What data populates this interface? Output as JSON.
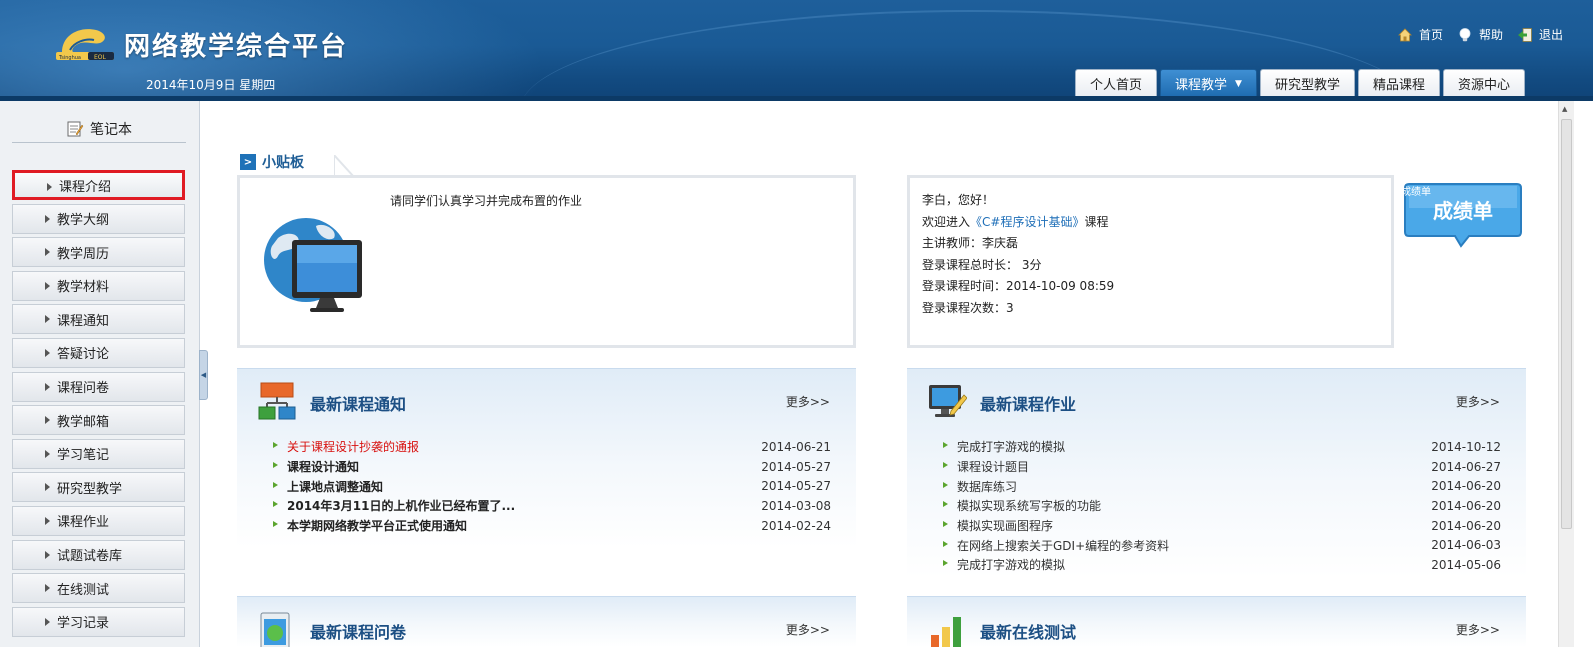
{
  "header": {
    "title": "网络教学综合平台",
    "logo_tag": "Tsinghua EOL",
    "date": "2014年10月9日 星期四",
    "links": [
      {
        "label": "首页",
        "icon": "home-icon"
      },
      {
        "label": "帮助",
        "icon": "lightbulb-help-icon"
      },
      {
        "label": "退出",
        "icon": "exit-icon"
      }
    ],
    "tabs": [
      {
        "label": "个人首页",
        "active": false
      },
      {
        "label": "课程教学",
        "active": true
      },
      {
        "label": "研究型教学",
        "active": false
      },
      {
        "label": "精品课程",
        "active": false
      },
      {
        "label": "资源中心",
        "active": false
      }
    ]
  },
  "sidebar": {
    "title": "笔记本",
    "items": [
      {
        "label": "课程介绍",
        "selected": true
      },
      {
        "label": "教学大纲"
      },
      {
        "label": "教学周历"
      },
      {
        "label": "教学材料"
      },
      {
        "label": "课程通知"
      },
      {
        "label": "答疑讨论"
      },
      {
        "label": "课程问卷"
      },
      {
        "label": "教学邮箱"
      },
      {
        "label": "学习笔记"
      },
      {
        "label": "研究型教学"
      },
      {
        "label": "课程作业"
      },
      {
        "label": "试题试卷库"
      },
      {
        "label": "在线测试"
      },
      {
        "label": "学习记录"
      }
    ]
  },
  "tipboard": {
    "title": "小贴板",
    "message": "请同学们认真学习并完成布置的作业"
  },
  "user_info": {
    "greeting": "李白，您好！",
    "welcome_prefix": "欢迎进入",
    "course": "《C#程序设计基础》",
    "welcome_suffix": "课程",
    "teacher": "主讲教师：李庆磊",
    "total_time": "登录课程总时长：  3分",
    "login_time": "登录课程时间：2014-10-09 08:59",
    "login_count": "登录课程次数：3"
  },
  "grade_card": {
    "label": "成绩单",
    "small_label": "成绩单"
  },
  "panels": {
    "notices": {
      "title": "最新课程通知",
      "more": "更多>>",
      "items": [
        {
          "title": "关于课程设计抄袭的通报",
          "date": "2014-06-21",
          "highlight": true
        },
        {
          "title": "课程设计通知",
          "date": "2014-05-27"
        },
        {
          "title": "上课地点调整通知",
          "date": "2014-05-27"
        },
        {
          "title": "2014年3月11日的上机作业已经布置了...",
          "date": "2014-03-08"
        },
        {
          "title": "本学期网络教学平台正式使用通知",
          "date": "2014-02-24"
        }
      ]
    },
    "homework": {
      "title": "最新课程作业",
      "more": "更多>>",
      "items": [
        {
          "title": "完成打字游戏的模拟",
          "date": "2014-10-12"
        },
        {
          "title": "课程设计题目",
          "date": "2014-06-27"
        },
        {
          "title": "数据库练习",
          "date": "2014-06-20"
        },
        {
          "title": "模拟实现系统写字板的功能",
          "date": "2014-06-20"
        },
        {
          "title": "模拟实现画图程序",
          "date": "2014-06-20"
        },
        {
          "title": "在网络上搜索关于GDI+编程的参考资料",
          "date": "2014-06-03"
        },
        {
          "title": "完成打字游戏的模拟",
          "date": "2014-05-06"
        }
      ]
    },
    "surveys": {
      "title": "最新课程问卷",
      "more": "更多>>"
    },
    "tests": {
      "title": "最新在线测试",
      "more": "更多>>"
    }
  },
  "colors": {
    "header_blue": "#1a5a95",
    "active_tab": "#1e6bb0",
    "selected_outline": "#e01b24",
    "panel_title": "#1c4f84",
    "notice_highlight": "#d8110f",
    "bullet_green": "#5ba52e"
  }
}
